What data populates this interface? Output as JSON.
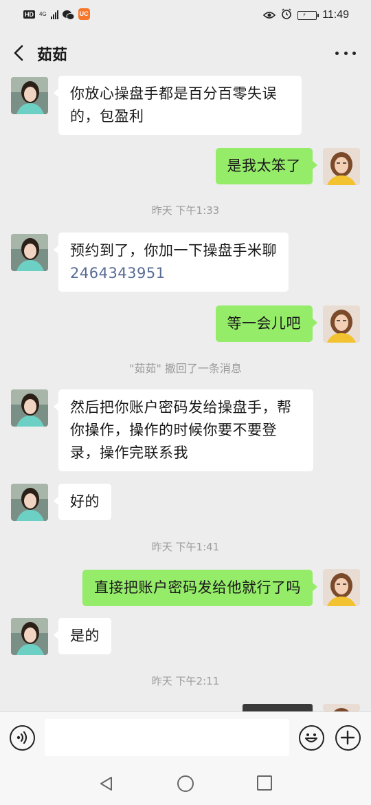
{
  "status_bar": {
    "hd": "HD",
    "network": "4G",
    "time": "11:49",
    "icons": [
      "signal-icon",
      "wechat-icon",
      "uc-browser-icon",
      "eye-comfort-icon",
      "alarm-icon",
      "battery-charging-icon"
    ]
  },
  "header": {
    "title": "茹茹",
    "back_icon": "chevron-left-icon",
    "more_icon": "more-dots-icon"
  },
  "messages": {
    "m1": "你放心操盘手都是百分百零失误的，包盈利",
    "m2": "是我太笨了",
    "ts1": "昨天 下午1:33",
    "m3_text": "预约到了，你加一下操盘手米聊",
    "m3_number": "2464343951",
    "m4": "等一会儿吧",
    "recall": "\"茹茹\" 撤回了一条消息",
    "m5": "然后把你账户密码发给操盘手，帮你操作，操作的时候你要不要登录，操作完联系我",
    "m6": "好的",
    "ts2": "昨天 下午1:41",
    "m7": "直接把账户密码发给他就行了吗",
    "m8": "是的",
    "ts3": "昨天 下午2:11"
  },
  "input_bar": {
    "placeholder": "",
    "voice_icon": "voice-icon",
    "emoji_icon": "emoji-icon",
    "plus_icon": "plus-icon"
  },
  "colors": {
    "background": "#ededed",
    "incoming_bubble": "#ffffff",
    "outgoing_bubble": "#95ec69",
    "link": "#576b95",
    "timestamp": "#9b9b9b"
  }
}
